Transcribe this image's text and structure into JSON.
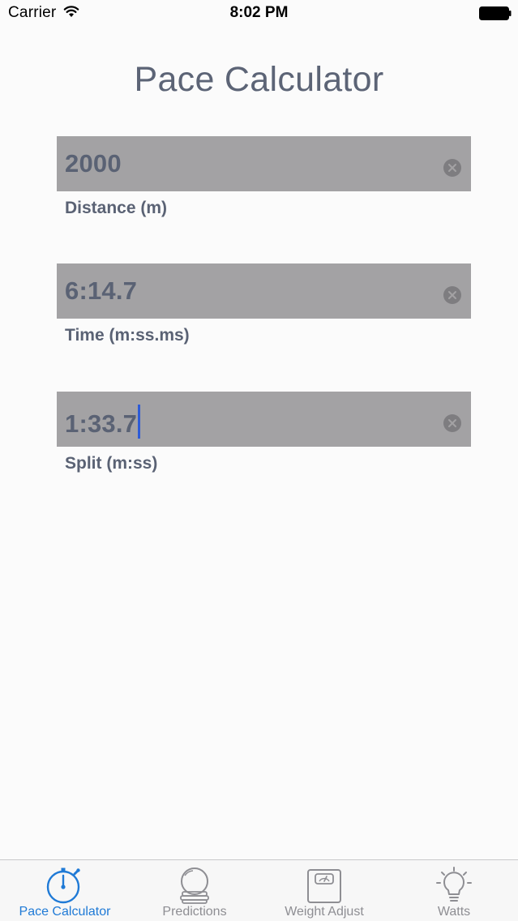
{
  "status_bar": {
    "carrier": "Carrier",
    "time": "8:02 PM"
  },
  "page": {
    "title": "Pace Calculator"
  },
  "fields": [
    {
      "value": "2000",
      "label": "Distance (m)"
    },
    {
      "value": "6:14.7",
      "label": "Time (m:ss.ms)"
    },
    {
      "value": "1:33.7",
      "label": "Split (m:ss)"
    }
  ],
  "tabs": [
    {
      "label": "Pace Calculator",
      "icon": "stopwatch-icon",
      "active": true
    },
    {
      "label": "Predictions",
      "icon": "crystal-ball-icon",
      "active": false
    },
    {
      "label": "Weight Adjust",
      "icon": "scale-icon",
      "active": false
    },
    {
      "label": "Watts",
      "icon": "light-bulb-icon",
      "active": false
    }
  ],
  "colors": {
    "accent": "#1f7ad6",
    "field_bg": "#a3a2a4",
    "field_text": "#5a6274",
    "caret": "#2d5bd6",
    "tab_inactive": "#8e8e93"
  }
}
